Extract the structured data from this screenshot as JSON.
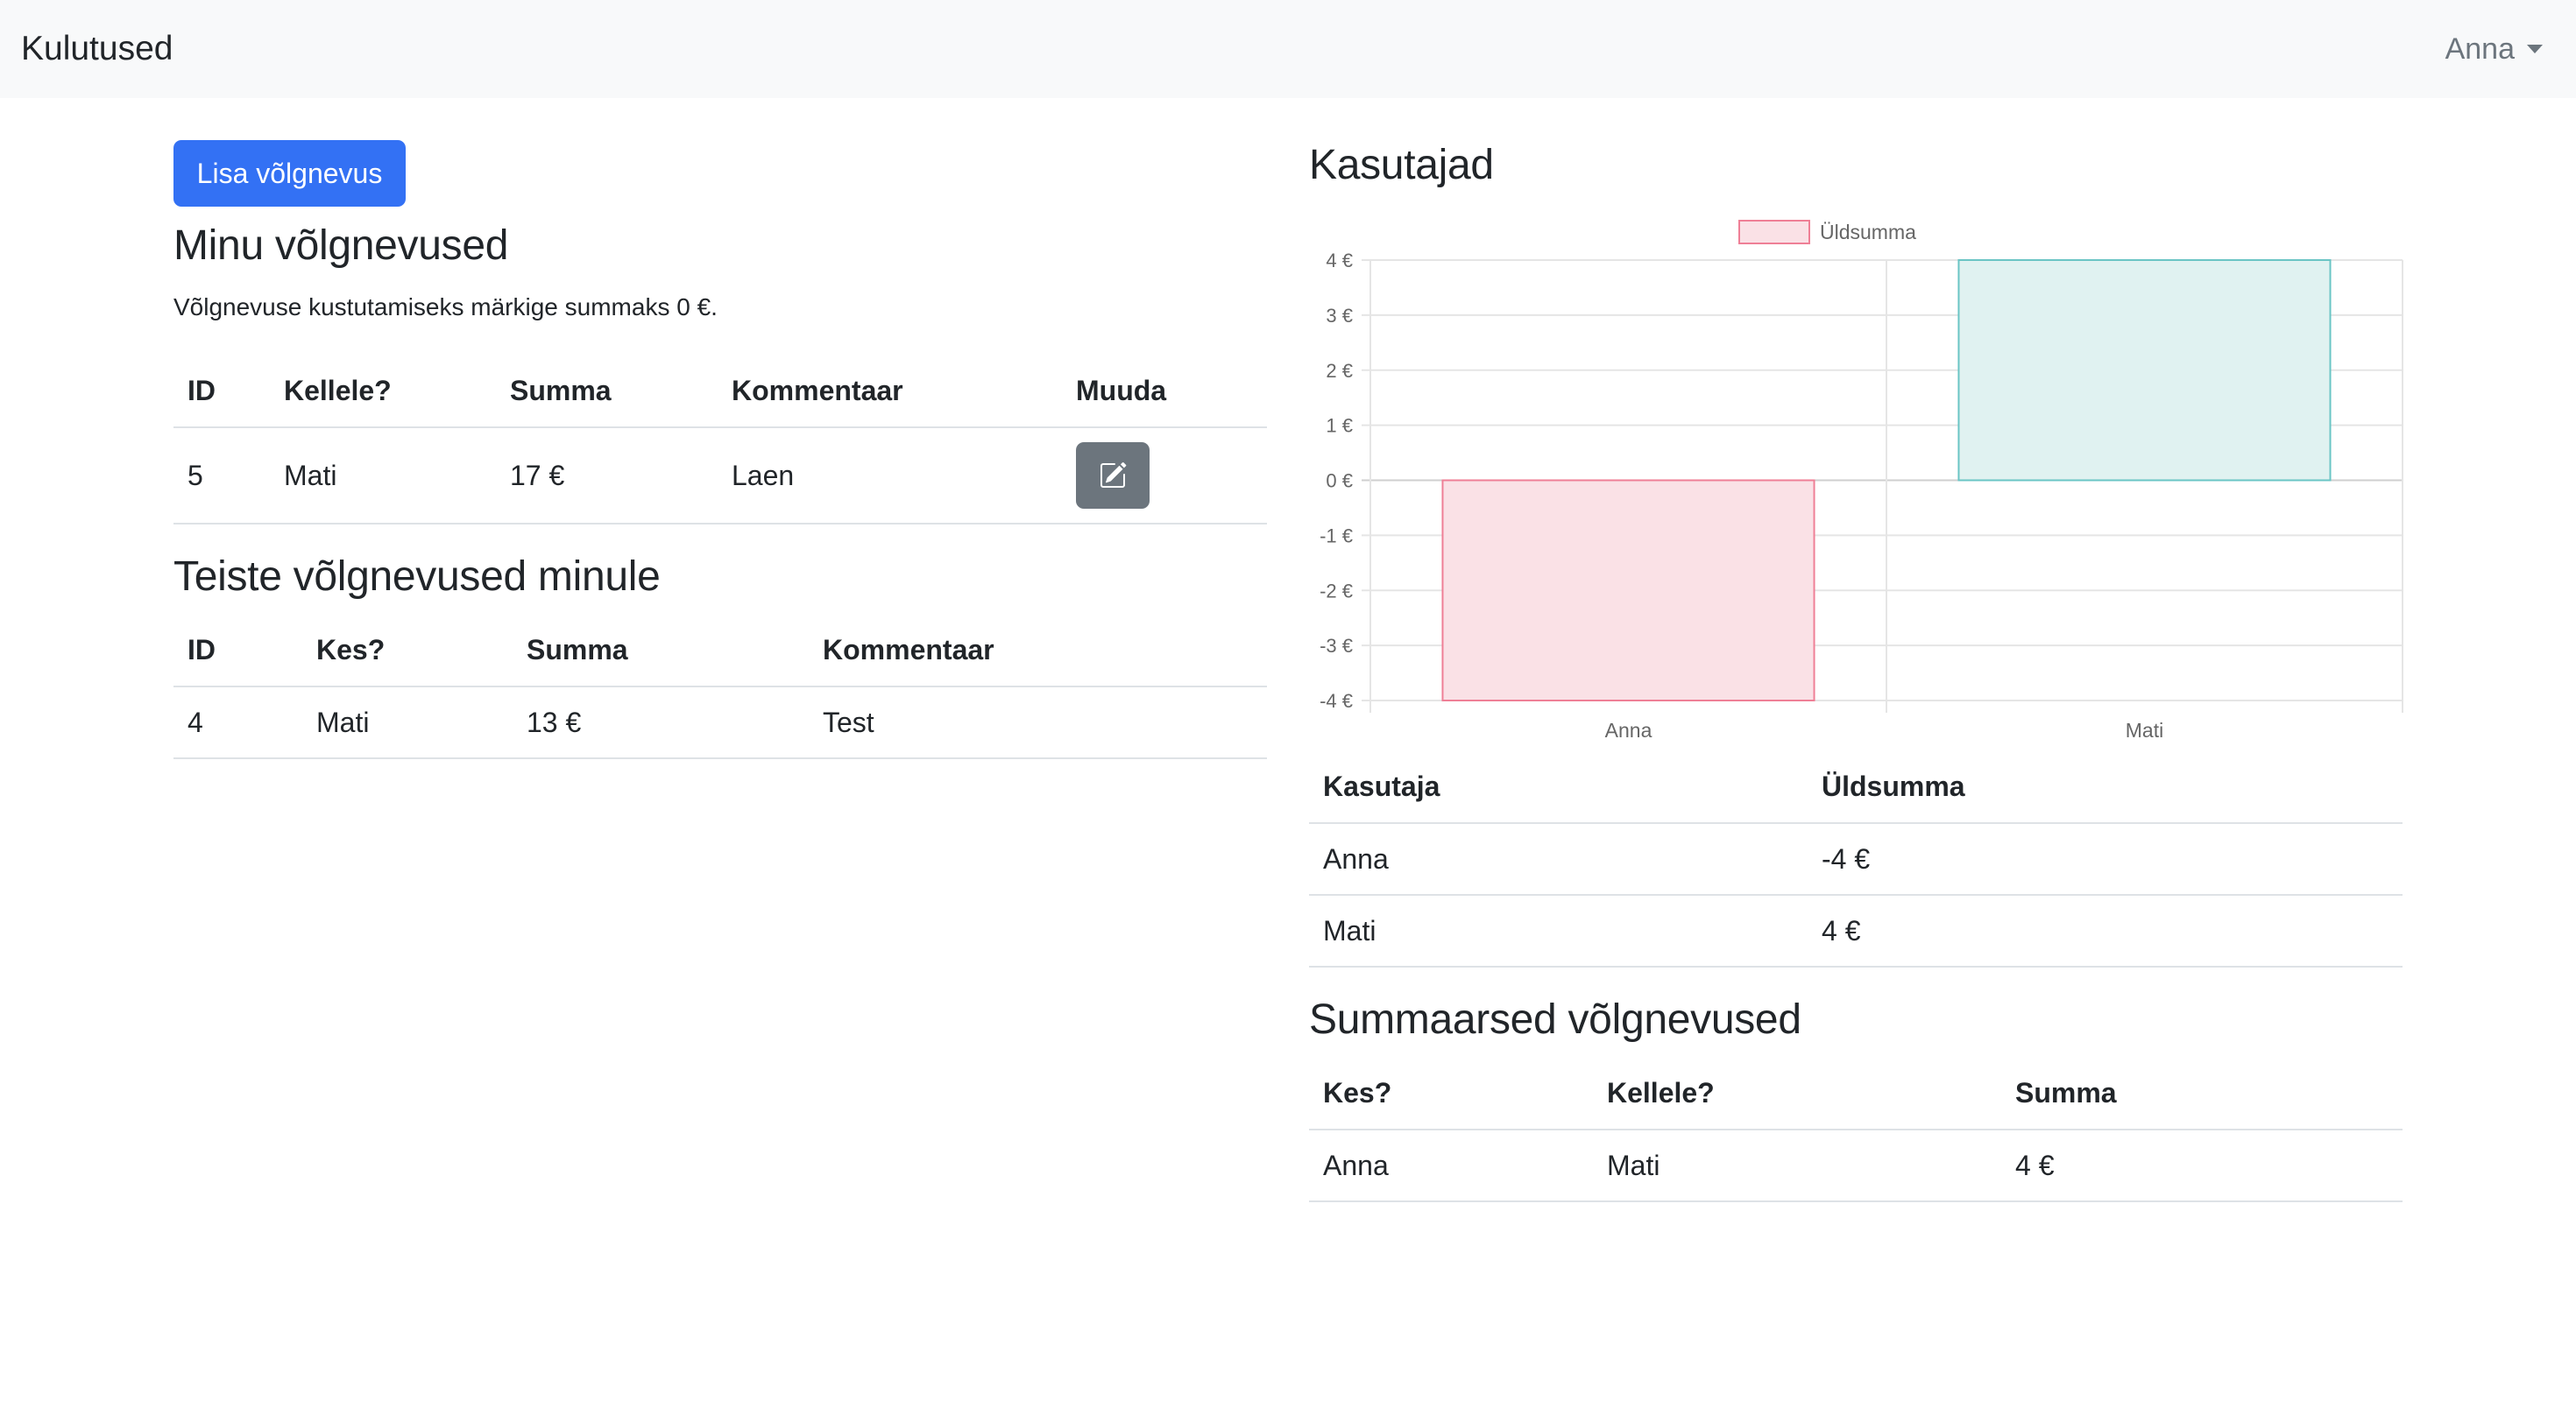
{
  "app": {
    "title": "Kulutused"
  },
  "user_menu": {
    "label": "Anna"
  },
  "actions": {
    "add_debt": "Lisa võlgnevus"
  },
  "my_debts": {
    "title": "Minu võlgnevused",
    "hint": "Võlgnevuse kustutamiseks märkige summaks 0 €.",
    "columns": [
      "ID",
      "Kellele?",
      "Summa",
      "Kommentaar",
      "Muuda"
    ],
    "rows": [
      {
        "id": "5",
        "to": "Mati",
        "amount": "17 €",
        "comment": "Laen",
        "edit_icon": "edit-icon"
      }
    ]
  },
  "others_debts": {
    "title": "Teiste võlgnevused minule",
    "columns": [
      "ID",
      "Kes?",
      "Summa",
      "Kommentaar"
    ],
    "rows": [
      {
        "id": "4",
        "who": "Mati",
        "amount": "13 €",
        "comment": "Test"
      }
    ]
  },
  "users": {
    "title": "Kasutajad",
    "columns": [
      "Kasutaja",
      "Üldsumma"
    ],
    "rows": [
      {
        "user": "Anna",
        "total": "-4 €"
      },
      {
        "user": "Mati",
        "total": "4 €"
      }
    ]
  },
  "summary_debts": {
    "title": "Summaarsed võlgnevused",
    "columns": [
      "Kes?",
      "Kellele?",
      "Summa"
    ],
    "rows": [
      {
        "who": "Anna",
        "to": "Mati",
        "amount": "4 €"
      }
    ]
  },
  "chart_data": {
    "type": "bar",
    "categories": [
      "Anna",
      "Mati"
    ],
    "series": [
      {
        "name": "Üldsumma",
        "values": [
          -4,
          4
        ],
        "fill_colors": [
          "#fae1e6",
          "#e0f2f1"
        ],
        "stroke_colors": [
          "#ef7f96",
          "#6ac5c5"
        ]
      }
    ],
    "ylim": [
      -4,
      4
    ],
    "y_ticks": [
      "4 €",
      "3 €",
      "2 €",
      "1 €",
      "0 €",
      "-1 €",
      "-2 €",
      "-3 €",
      "-4 €"
    ],
    "y_tick_values": [
      4,
      3,
      2,
      1,
      0,
      -1,
      -2,
      -3,
      -4
    ],
    "legend_position": "top-center",
    "grid": true
  }
}
